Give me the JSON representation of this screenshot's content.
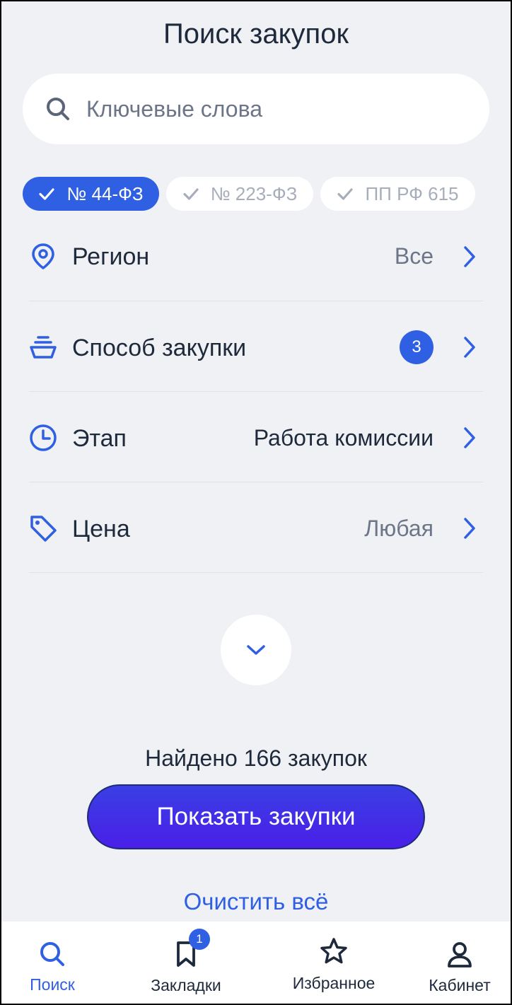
{
  "page": {
    "title": "Поиск закупок"
  },
  "search": {
    "placeholder": "Ключевые слова"
  },
  "law_chips": [
    {
      "label": "№ 44-ФЗ",
      "active": true
    },
    {
      "label": "№ 223-ФЗ",
      "active": false
    },
    {
      "label": "ПП РФ 615",
      "active": false
    }
  ],
  "filters": {
    "region": {
      "label": "Регион",
      "value": "Все"
    },
    "method": {
      "label": "Способ закупки",
      "badge": "3"
    },
    "stage": {
      "label": "Этап",
      "value": "Работа комиссии"
    },
    "price": {
      "label": "Цена",
      "value": "Любая"
    }
  },
  "results": {
    "found_text": "Найдено 166 закупок",
    "show_button": "Показать закупки",
    "clear_all": "Очистить всё"
  },
  "tabbar": {
    "items": [
      {
        "label": "Поиск",
        "icon": "search-icon",
        "active": true
      },
      {
        "label": "Закладки",
        "icon": "bookmark-icon",
        "badge": "1"
      },
      {
        "label": "Избранное",
        "icon": "star-icon"
      },
      {
        "label": "Кабинет",
        "icon": "user-icon"
      }
    ]
  },
  "colors": {
    "accent": "#2f5fe3",
    "background": "#eff1f4",
    "text": "#1e2a3b",
    "muted": "#6c7688",
    "button_gradient_start": "#3a3fe4",
    "button_gradient_end": "#4a1fe8"
  }
}
